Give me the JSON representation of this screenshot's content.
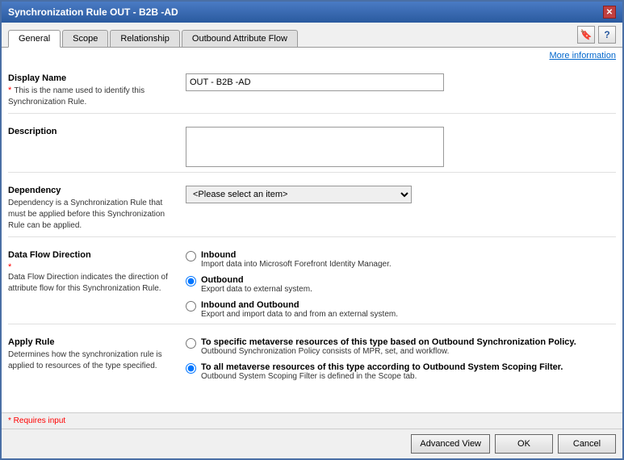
{
  "window": {
    "title": "Synchronization Rule OUT - B2B -AD",
    "close_label": "✕"
  },
  "tabs": [
    {
      "id": "general",
      "label": "General",
      "active": true
    },
    {
      "id": "scope",
      "label": "Scope",
      "active": false
    },
    {
      "id": "relationship",
      "label": "Relationship",
      "active": false
    },
    {
      "id": "outbound",
      "label": "Outbound Attribute Flow",
      "active": false
    }
  ],
  "toolbar": {
    "bookmark_icon": "🔖",
    "help_icon": "?"
  },
  "more_info_link": "More information",
  "form": {
    "display_name": {
      "label": "Display Name",
      "required": "*",
      "description": "This is the name used to identify this Synchronization Rule.",
      "value": "OUT - B2B -AD"
    },
    "description": {
      "label": "Description",
      "value": ""
    },
    "dependency": {
      "label": "Dependency",
      "description": "Dependency is a Synchronization Rule that must be applied before this Synchronization Rule can be applied.",
      "placeholder": "<Please select an item>",
      "options": [
        "<Please select an item>"
      ]
    },
    "data_flow_direction": {
      "label": "Data Flow Direction",
      "required": "*",
      "description": "Data Flow Direction indicates the direction of attribute flow for this Synchronization Rule.",
      "options": [
        {
          "value": "inbound",
          "label": "Inbound",
          "desc": "Import data into Microsoft Forefront Identity Manager.",
          "checked": false
        },
        {
          "value": "outbound",
          "label": "Outbound",
          "desc": "Export data to external system.",
          "checked": true
        },
        {
          "value": "inbound_outbound",
          "label": "Inbound and Outbound",
          "desc": "Export and import data to and from an external system.",
          "checked": false
        }
      ]
    },
    "apply_rule": {
      "label": "Apply Rule",
      "description": "Determines how the synchronization rule is applied to resources of the type specified.",
      "options": [
        {
          "value": "specific",
          "label": "To specific metaverse resources of this type based on Outbound Synchronization Policy.",
          "desc": "Outbound Synchronization Policy consists of MPR, set, and workflow.",
          "checked": false
        },
        {
          "value": "all",
          "label": "To all metaverse resources of this type according to Outbound System Scoping Filter.",
          "desc": "Outbound System Scoping Filter is defined in the Scope tab.",
          "checked": true
        }
      ]
    }
  },
  "footer": {
    "requires_input": "* Requires input"
  },
  "buttons": {
    "advanced_view": "Advanced View",
    "ok": "OK",
    "cancel": "Cancel"
  }
}
